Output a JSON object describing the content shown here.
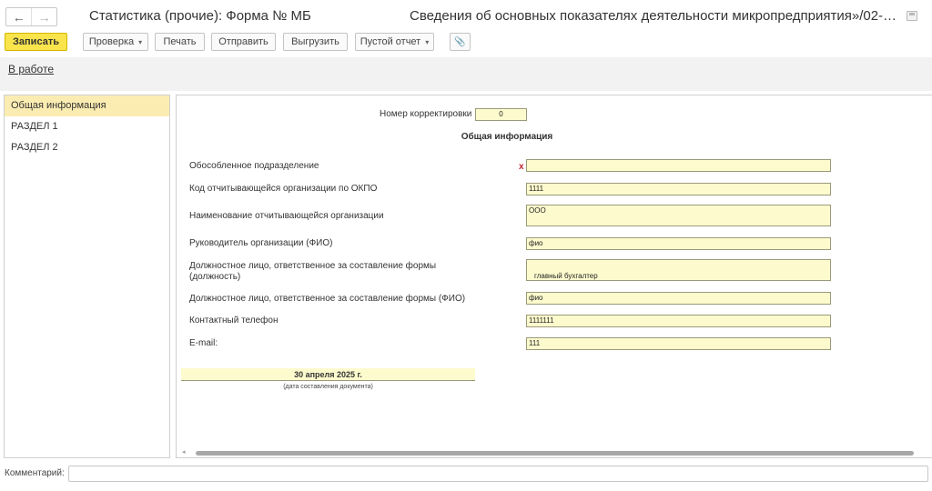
{
  "header": {
    "back_icon": "←",
    "forward_icon": "→",
    "title": "Статистика (прочие): Форма № МБ",
    "document_title": "Сведения об основных показателях деятельности микропредприятия»/02-…"
  },
  "toolbar": {
    "save_label": "Записать",
    "check_label": "Проверка",
    "print_label": "Печать",
    "send_label": "Отправить",
    "export_label": "Выгрузить",
    "empty_report_label": "Пустой отчет",
    "caret": "▾",
    "attach_icon": "📎"
  },
  "status": {
    "link": "В работе"
  },
  "sidebar": {
    "items": [
      {
        "label": "Общая информация"
      },
      {
        "label": "РАЗДЕЛ 1"
      },
      {
        "label": "РАЗДЕЛ 2"
      }
    ]
  },
  "form": {
    "correction_label": "Номер корректировки",
    "correction_value": "0",
    "section_heading": "Общая информация",
    "required_mark": "x",
    "fields": [
      {
        "label": "Обособленное подразделение",
        "value": ""
      },
      {
        "label": "Код отчитывающейся организации по ОКПО",
        "value": "1111"
      },
      {
        "label": "Наименование отчитывающейся организации",
        "value": "ООО"
      },
      {
        "label": "Руководитель организации (ФИО)",
        "value": "фио"
      },
      {
        "label_line1": "Должностное лицо, ответственное за составление формы",
        "label_line2": "(должность)",
        "value": "главный бухгалтер"
      },
      {
        "label": "Должностное лицо, ответственное за составление формы (ФИО)",
        "value": "фио"
      },
      {
        "label": "Контактный телефон",
        "value": "1111111"
      },
      {
        "label": "E-mail:",
        "value": "111"
      }
    ],
    "date_value": "30 апреля 2025 г.",
    "date_caption": "(дата составления документа)",
    "scroll_left_icon": "◂"
  },
  "comment": {
    "label": "Комментарий:",
    "value": ""
  },
  "colors": {
    "primary_button": "#f9e44c",
    "active_sidebar": "#fbecb1",
    "field_background": "#fdfbcd",
    "required_mark": "#c0282d"
  }
}
